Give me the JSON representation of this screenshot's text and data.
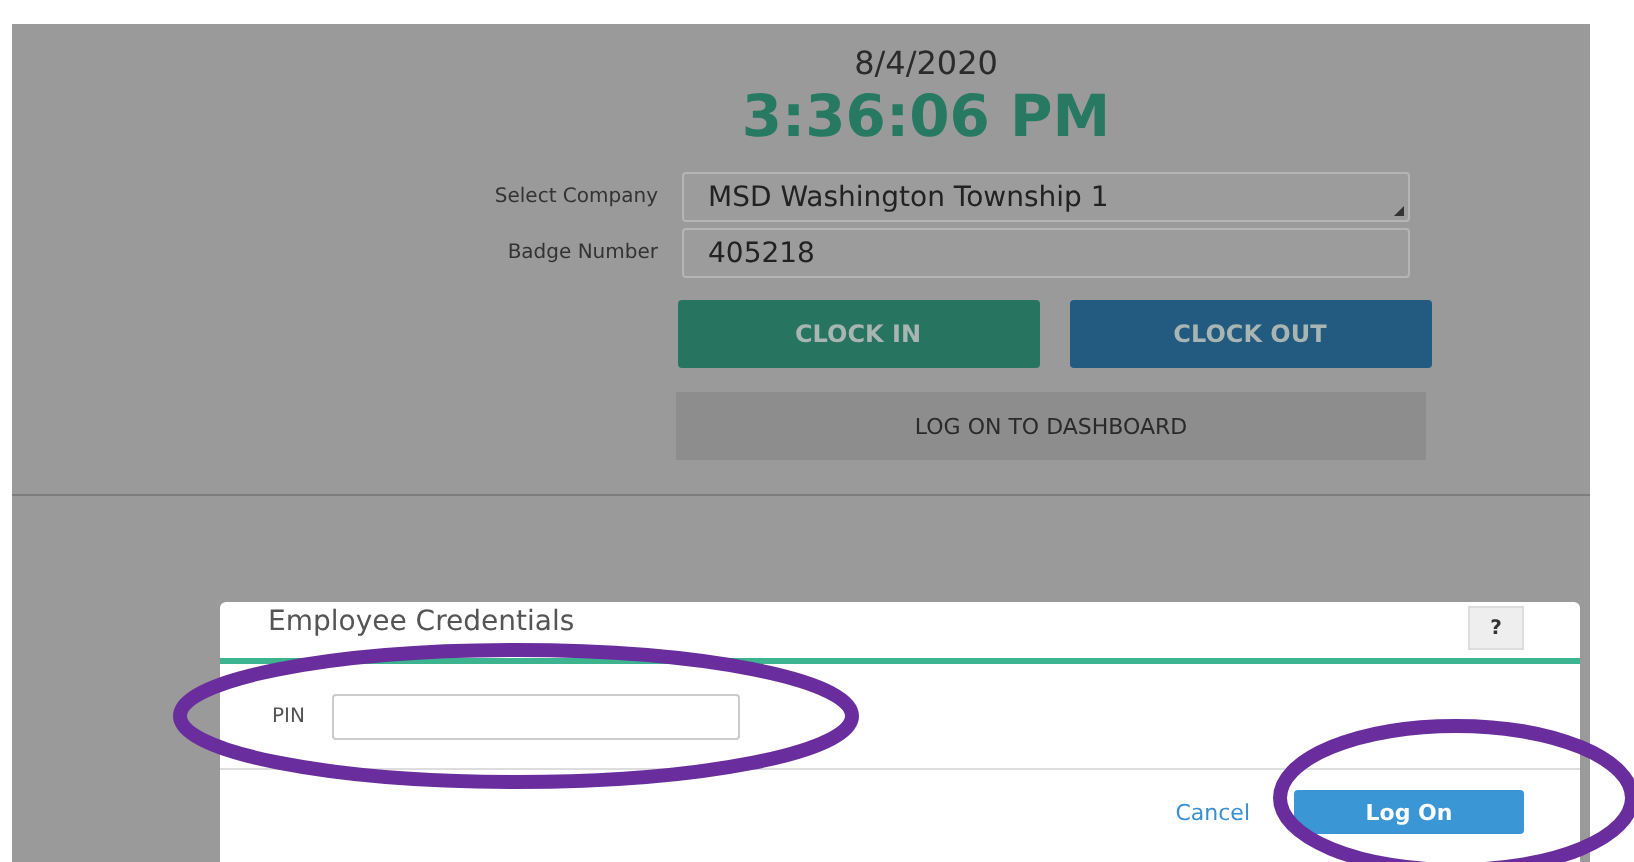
{
  "clock": {
    "date": "8/4/2020",
    "time": "3:36:06 PM"
  },
  "form": {
    "fields": [
      {
        "label": "Select Company",
        "value": "MSD Washington Township  1",
        "kind": "select"
      },
      {
        "label": "Badge Number",
        "value": "405218",
        "kind": "text"
      }
    ],
    "buttons": [
      {
        "label": "CLOCK IN",
        "kind": "clock-in"
      },
      {
        "label": "CLOCK OUT",
        "kind": "clock-out"
      }
    ],
    "dashboard_button": "LOG ON TO DASHBOARD"
  },
  "dialog": {
    "title": "Employee Credentials",
    "help": "?",
    "pin_label": "PIN",
    "cancel": "Cancel",
    "submit": "Log On"
  }
}
